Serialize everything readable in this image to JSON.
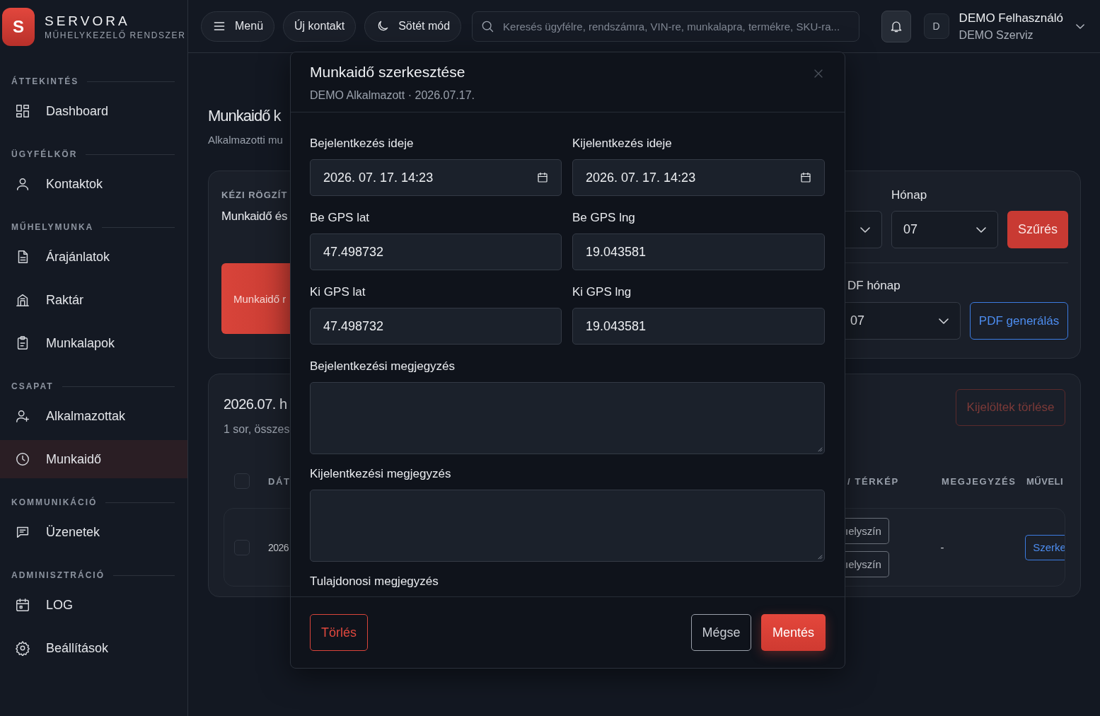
{
  "brand": {
    "logo_letter": "S",
    "name": "SERVORA",
    "tagline": "MŰHELYKEZELŐ RENDSZER"
  },
  "sidebar": {
    "sections": [
      {
        "label": "ÁTTEKINTÉS",
        "items": [
          {
            "kind": "grid",
            "label": "Dashboard",
            "selected": false
          }
        ]
      },
      {
        "label": "ÜGYFÉLKÖR",
        "items": [
          {
            "kind": "person",
            "label": "Kontaktok",
            "selected": false
          }
        ]
      },
      {
        "label": "MŰHELYMUNKA",
        "items": [
          {
            "kind": "document",
            "label": "Árajánlatok",
            "selected": false
          },
          {
            "kind": "building",
            "label": "Raktár",
            "selected": false
          },
          {
            "kind": "clipboard",
            "label": "Munkalapok",
            "selected": false
          }
        ]
      },
      {
        "label": "CSAPAT",
        "items": [
          {
            "kind": "person-plus",
            "label": "Alkalmazottak",
            "selected": false
          },
          {
            "kind": "clock",
            "label": "Munkaidő",
            "selected": true
          }
        ]
      },
      {
        "label": "KOMMUNIKÁCIÓ",
        "items": [
          {
            "kind": "chat",
            "label": "Üzenetek",
            "selected": false
          }
        ]
      },
      {
        "label": "ADMINISZTRÁCIÓ",
        "items": [
          {
            "kind": "calendar",
            "label": "LOG",
            "selected": false
          },
          {
            "kind": "gear",
            "label": "Beállítások",
            "selected": false
          }
        ]
      }
    ]
  },
  "topbar": {
    "buttons": [
      {
        "kind": "menu",
        "label": "Menü"
      },
      {
        "kind": "plain",
        "label": "Új kontakt"
      },
      {
        "kind": "moon",
        "label": "Sötét mód"
      }
    ],
    "search": {
      "placeholder": "Keresés ügyfélre, rendszámra, VIN-re, munkalapra, termékre, SKU-ra..."
    },
    "user": {
      "avatar": "D",
      "name": "DEMO Felhasználó",
      "org": "DEMO Szerviz"
    }
  },
  "page": {
    "title": "Munkaidő k",
    "subtitle": "Alkalmazotti mu"
  },
  "entry_card": {
    "eyebrow": "KÉZI RÖGZÍT",
    "heading": "Munkaidő és",
    "button": "Munkaidő r",
    "month_label": "Hónap",
    "month_value": "07",
    "filter_button": "Szűrés",
    "pdf_label": "DF hónap",
    "pdf_value": "07",
    "pdf_button": "PDF generálás"
  },
  "list_card": {
    "title": "2026.07. h",
    "summary": "1 sor, összes",
    "delete_selected": {
      "label": "Kijelöltek törlése",
      "disabled": true
    },
    "select_all": {
      "checked": false
    },
    "columns": [
      "DÁT",
      "/ TÉRKÉP",
      "MEGJEGYZÉS",
      "MŰVELI"
    ],
    "rows": [
      {
        "checked": false,
        "date": "2026",
        "map_buttons": [
          "ıelyszín",
          "ıelyszín"
        ],
        "note": "-",
        "action": "Szerke"
      }
    ]
  },
  "modal": {
    "title": "Munkaidő szerkesztése",
    "subtitle": "DEMO Alkalmazott · 2026.07.17.",
    "fields": [
      {
        "kind": "datetime",
        "label": "Bejelentkezés ideje",
        "value": "2026. 07. 17. 14:23"
      },
      {
        "kind": "datetime",
        "label": "Kijelentkezés ideje",
        "value": "2026. 07. 17. 14:23"
      },
      {
        "kind": "text",
        "label": "Be GPS lat",
        "value": "47.498732"
      },
      {
        "kind": "text",
        "label": "Be GPS lng",
        "value": "19.043581"
      },
      {
        "kind": "text",
        "label": "Ki GPS lat",
        "value": "47.498732"
      },
      {
        "kind": "text",
        "label": "Ki GPS lng",
        "value": "19.043581"
      },
      {
        "kind": "textarea",
        "label": "Bejelentkezési megjegyzés"
      },
      {
        "kind": "textarea",
        "label": "Kijelentkezési megjegyzés"
      },
      {
        "kind": "label",
        "label": "Tulajdonosi megjegyzés"
      }
    ],
    "delete_button": "Törlés",
    "cancel_button": "Mégse",
    "save_button": "Mentés"
  }
}
